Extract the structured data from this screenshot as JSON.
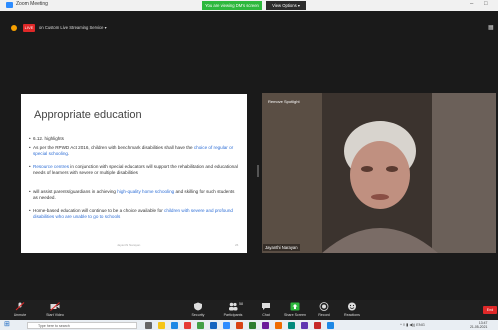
{
  "window": {
    "title": "Zoom Meeting"
  },
  "banner": {
    "sharing_text": "You are viewing DM's screen",
    "view_options": "View Options ▾"
  },
  "live": {
    "badge": "LIVE",
    "label": "on Custom Live Streaming Service ▾"
  },
  "slide": {
    "title": "Appropriate education",
    "bullets": {
      "b1": "6.12. highlights",
      "b2a": "As per the RPWD Act 2016, children with benchmark disabilities shall have the ",
      "b2b": "choice of regular or special schooling",
      "b2c": ".",
      "b3a": "Resource centres",
      "b3b": " in conjunction with special educators will support the rehabilitation and educational needs of learners with severe or multiple disabilities",
      "b4a": "will assist parents/guardians in achieving ",
      "b4b": "high-quality home schooling",
      "b4c": " and skilling for such students as needed.",
      "b5a": "Home-based education will continue to be a choice available for ",
      "b5b": "children with severe and profound disabilities who are unable to go to schools"
    },
    "footer": "Jayanthi Narayan",
    "page": "26"
  },
  "video": {
    "label": "Remove Spotlight",
    "name": "Jayanthi Narayan"
  },
  "toolbar": {
    "mute": "Unmute",
    "video": "Start Video",
    "security": "Security",
    "participants": "Participants",
    "participants_count": "58",
    "chat": "Chat",
    "share": "Share Screen",
    "record": "Record",
    "reactions": "Reactions",
    "end": "End"
  },
  "taskbar": {
    "search": "Type here to search",
    "time": "13:47",
    "date": "21-05-2021"
  },
  "colors": {
    "accent": "#2d8cff",
    "live": "#e02828",
    "share_green": "#2db83d",
    "slide_blue": "#2f6fd6"
  }
}
